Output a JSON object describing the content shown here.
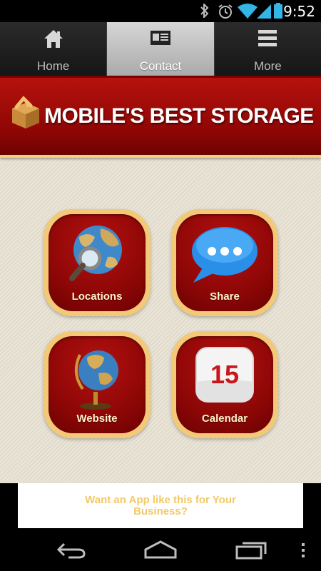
{
  "status_bar": {
    "time": "9:52",
    "icons": [
      "bluetooth-icon",
      "alarm-icon",
      "wifi-icon",
      "signal-icon",
      "battery-icon"
    ]
  },
  "tabs": [
    {
      "label": "Home",
      "icon": "home-icon",
      "active": false
    },
    {
      "label": "Contact",
      "icon": "contact-card-icon",
      "active": true
    },
    {
      "label": "More",
      "icon": "menu-icon",
      "active": false
    }
  ],
  "banner": {
    "title": "MOBILE'S BEST STORAGE",
    "logo_icon": "storage-box-icon"
  },
  "tiles": [
    {
      "label": "Locations",
      "icon": "globe-magnifier-icon"
    },
    {
      "label": "Share",
      "icon": "chat-bubble-icon"
    },
    {
      "label": "Website",
      "icon": "desk-globe-icon"
    },
    {
      "label": "Calendar",
      "icon": "calendar-icon",
      "calendar_day": "15"
    }
  ],
  "ad": {
    "text": "Want an App like this for Your Business?"
  },
  "nav": {
    "icons": [
      "back-icon",
      "home-nav-icon",
      "recent-apps-icon",
      "overflow-menu-icon"
    ]
  },
  "colors": {
    "banner_red": "#9e0b08",
    "tile_border": "#f3c978",
    "tile_label": "#fff3c8",
    "ad_text": "#f2c96a",
    "background": "#e5dfd0"
  }
}
